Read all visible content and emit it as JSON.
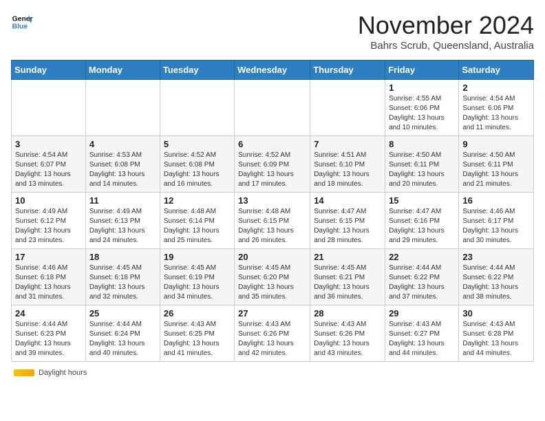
{
  "header": {
    "logo_line1": "General",
    "logo_line2": "Blue",
    "month": "November 2024",
    "location": "Bahrs Scrub, Queensland, Australia"
  },
  "weekdays": [
    "Sunday",
    "Monday",
    "Tuesday",
    "Wednesday",
    "Thursday",
    "Friday",
    "Saturday"
  ],
  "footer": {
    "daylight_label": "Daylight hours"
  },
  "weeks": [
    [
      {
        "day": "",
        "info": ""
      },
      {
        "day": "",
        "info": ""
      },
      {
        "day": "",
        "info": ""
      },
      {
        "day": "",
        "info": ""
      },
      {
        "day": "",
        "info": ""
      },
      {
        "day": "1",
        "info": "Sunrise: 4:55 AM\nSunset: 6:06 PM\nDaylight: 13 hours and 10 minutes."
      },
      {
        "day": "2",
        "info": "Sunrise: 4:54 AM\nSunset: 6:06 PM\nDaylight: 13 hours and 11 minutes."
      }
    ],
    [
      {
        "day": "3",
        "info": "Sunrise: 4:54 AM\nSunset: 6:07 PM\nDaylight: 13 hours and 13 minutes."
      },
      {
        "day": "4",
        "info": "Sunrise: 4:53 AM\nSunset: 6:08 PM\nDaylight: 13 hours and 14 minutes."
      },
      {
        "day": "5",
        "info": "Sunrise: 4:52 AM\nSunset: 6:08 PM\nDaylight: 13 hours and 16 minutes."
      },
      {
        "day": "6",
        "info": "Sunrise: 4:52 AM\nSunset: 6:09 PM\nDaylight: 13 hours and 17 minutes."
      },
      {
        "day": "7",
        "info": "Sunrise: 4:51 AM\nSunset: 6:10 PM\nDaylight: 13 hours and 18 minutes."
      },
      {
        "day": "8",
        "info": "Sunrise: 4:50 AM\nSunset: 6:11 PM\nDaylight: 13 hours and 20 minutes."
      },
      {
        "day": "9",
        "info": "Sunrise: 4:50 AM\nSunset: 6:11 PM\nDaylight: 13 hours and 21 minutes."
      }
    ],
    [
      {
        "day": "10",
        "info": "Sunrise: 4:49 AM\nSunset: 6:12 PM\nDaylight: 13 hours and 23 minutes."
      },
      {
        "day": "11",
        "info": "Sunrise: 4:49 AM\nSunset: 6:13 PM\nDaylight: 13 hours and 24 minutes."
      },
      {
        "day": "12",
        "info": "Sunrise: 4:48 AM\nSunset: 6:14 PM\nDaylight: 13 hours and 25 minutes."
      },
      {
        "day": "13",
        "info": "Sunrise: 4:48 AM\nSunset: 6:15 PM\nDaylight: 13 hours and 26 minutes."
      },
      {
        "day": "14",
        "info": "Sunrise: 4:47 AM\nSunset: 6:15 PM\nDaylight: 13 hours and 28 minutes."
      },
      {
        "day": "15",
        "info": "Sunrise: 4:47 AM\nSunset: 6:16 PM\nDaylight: 13 hours and 29 minutes."
      },
      {
        "day": "16",
        "info": "Sunrise: 4:46 AM\nSunset: 6:17 PM\nDaylight: 13 hours and 30 minutes."
      }
    ],
    [
      {
        "day": "17",
        "info": "Sunrise: 4:46 AM\nSunset: 6:18 PM\nDaylight: 13 hours and 31 minutes."
      },
      {
        "day": "18",
        "info": "Sunrise: 4:45 AM\nSunset: 6:18 PM\nDaylight: 13 hours and 32 minutes."
      },
      {
        "day": "19",
        "info": "Sunrise: 4:45 AM\nSunset: 6:19 PM\nDaylight: 13 hours and 34 minutes."
      },
      {
        "day": "20",
        "info": "Sunrise: 4:45 AM\nSunset: 6:20 PM\nDaylight: 13 hours and 35 minutes."
      },
      {
        "day": "21",
        "info": "Sunrise: 4:45 AM\nSunset: 6:21 PM\nDaylight: 13 hours and 36 minutes."
      },
      {
        "day": "22",
        "info": "Sunrise: 4:44 AM\nSunset: 6:22 PM\nDaylight: 13 hours and 37 minutes."
      },
      {
        "day": "23",
        "info": "Sunrise: 4:44 AM\nSunset: 6:22 PM\nDaylight: 13 hours and 38 minutes."
      }
    ],
    [
      {
        "day": "24",
        "info": "Sunrise: 4:44 AM\nSunset: 6:23 PM\nDaylight: 13 hours and 39 minutes."
      },
      {
        "day": "25",
        "info": "Sunrise: 4:44 AM\nSunset: 6:24 PM\nDaylight: 13 hours and 40 minutes."
      },
      {
        "day": "26",
        "info": "Sunrise: 4:43 AM\nSunset: 6:25 PM\nDaylight: 13 hours and 41 minutes."
      },
      {
        "day": "27",
        "info": "Sunrise: 4:43 AM\nSunset: 6:26 PM\nDaylight: 13 hours and 42 minutes."
      },
      {
        "day": "28",
        "info": "Sunrise: 4:43 AM\nSunset: 6:26 PM\nDaylight: 13 hours and 43 minutes."
      },
      {
        "day": "29",
        "info": "Sunrise: 4:43 AM\nSunset: 6:27 PM\nDaylight: 13 hours and 44 minutes."
      },
      {
        "day": "30",
        "info": "Sunrise: 4:43 AM\nSunset: 6:28 PM\nDaylight: 13 hours and 44 minutes."
      }
    ]
  ]
}
